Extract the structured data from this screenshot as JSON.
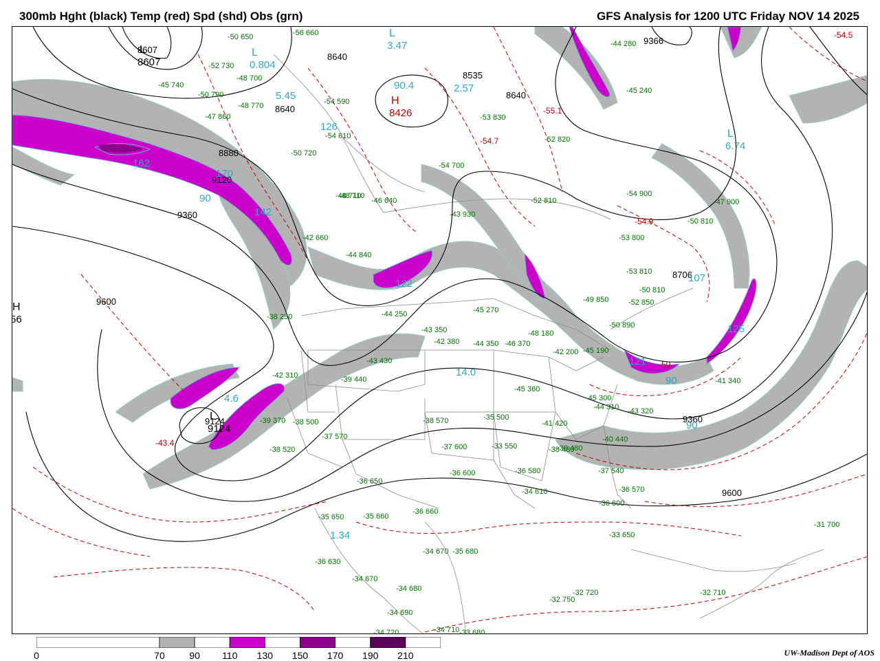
{
  "header": {
    "left_title": "300mb Hght (black) Temp (red) Spd (shd) Obs (grn)",
    "right_title": "GFS Analysis for 1200 UTC Friday  NOV 14 2025"
  },
  "colors": {
    "height_contours": "#000000",
    "temperature": "#c00000",
    "obs": "#007000",
    "jet_labels": "#2aa9c4",
    "speed_70_90": "#b3b3b3",
    "speed_110_130": "#cc00cc",
    "speed_150_170": "#8c008c",
    "speed_190_210": "#5a005a",
    "borders": "#888888"
  },
  "height_labels": [
    {
      "text": "8607"
    },
    {
      "text": "8640"
    },
    {
      "text": "8640"
    },
    {
      "text": "8535"
    },
    {
      "text": "8640"
    },
    {
      "text": "8880"
    },
    {
      "text": "9120"
    },
    {
      "text": "9360"
    },
    {
      "text": "9600"
    },
    {
      "text": "9124"
    },
    {
      "text": "9360"
    },
    {
      "text": "9600"
    },
    {
      "text": "9366"
    },
    {
      "text": "8706"
    }
  ],
  "centers": [
    {
      "letter": "L",
      "value": "8607"
    },
    {
      "letter": "L",
      "value": "0.804"
    },
    {
      "letter": "L",
      "value": "3.47"
    },
    {
      "letter": "H",
      "value": "8426"
    },
    {
      "letter": "L",
      "value": "6.74"
    },
    {
      "letter": "L",
      "value": "9124"
    },
    {
      "letter": "H",
      "value": "56"
    }
  ],
  "jet_speed_labels": [
    "162",
    "170",
    "90",
    "142",
    "122",
    "14.0",
    "125",
    "121",
    "90",
    "4.6",
    "1.34",
    "90.4",
    "2.57",
    "126",
    "90",
    "107",
    "5.45"
  ],
  "temperature_labels": [
    "-54.5",
    "-55.1",
    "-54.7",
    "-54.9",
    "-43.4",
    "-50"
  ],
  "obs": [
    "-50 650",
    "-56 660",
    "-52 730",
    "-48 700",
    "-45 740",
    "-50 790",
    "-48 770",
    "-47 860",
    "-54 590",
    "-54 610",
    "-54 700",
    "-52 810",
    "-52 820",
    "-53 830",
    "-44 280",
    "-45 240",
    "-50 720",
    "-48 710",
    "-46 640",
    "-48 710",
    "-42 660",
    "-44 840",
    "-43 930",
    "-54 900",
    "-50 810",
    "-53 800",
    "-47 900",
    "-53 810",
    "-50 810",
    "-49 850",
    "-52 850",
    "-50 890",
    "-38 250",
    "-44 250",
    "-43 350",
    "-42 380",
    "-44 350",
    "-46 370",
    "-45 270",
    "-48 180",
    "-42 200",
    "-45 190",
    "-42 310",
    "-39 440",
    "-43 430",
    "-39 370",
    "-38 500",
    "-37 570",
    "-38 520",
    "-38 570",
    "-37 600",
    "-35 500",
    "-33 550",
    "-36 600",
    "-36 650",
    "-35 650",
    "-35 660",
    "-36 660",
    "-41 340",
    "-45 300",
    "-44 310",
    "-43 320",
    "-40 440",
    "-39 480",
    "-37 540",
    "-36 570",
    "-36 600",
    "-33 650",
    "-31 700",
    "-36 580",
    "-34 610",
    "-36 630",
    "-34 670",
    "-34 680",
    "-34 670",
    "-35 680",
    "-34 690",
    "-34 720",
    "-34 710",
    "-33 680",
    "-32 750",
    "-32 720",
    "-32 710",
    "-41 420",
    "-38 480",
    "-45 360"
  ],
  "legend": {
    "ticks": [
      "0",
      "70",
      "90",
      "110",
      "130",
      "150",
      "170",
      "190",
      "210"
    ],
    "bins": [
      {
        "from": 0,
        "to": 70,
        "color": "#ffffff"
      },
      {
        "from": 70,
        "to": 90,
        "color": "#b3b3b3"
      },
      {
        "from": 90,
        "to": 110,
        "color": "#ffffff"
      },
      {
        "from": 110,
        "to": 130,
        "color": "#cc00cc"
      },
      {
        "from": 130,
        "to": 150,
        "color": "#ffffff"
      },
      {
        "from": 150,
        "to": 170,
        "color": "#8c008c"
      },
      {
        "from": 170,
        "to": 190,
        "color": "#ffffff"
      },
      {
        "from": 190,
        "to": 210,
        "color": "#5a005a"
      },
      {
        "from": 210,
        "to": 230,
        "color": "#ffffff"
      }
    ]
  },
  "credit": "UW-Madison  Dept of AOS"
}
